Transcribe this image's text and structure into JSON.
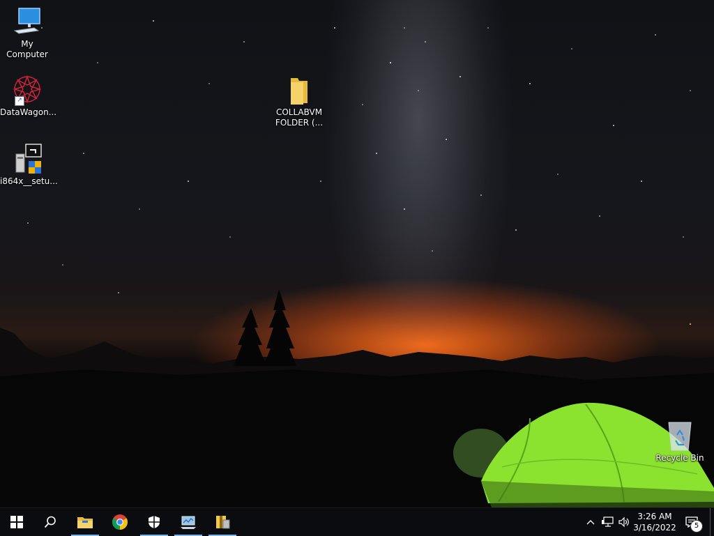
{
  "desktop": {
    "icons": [
      {
        "label": "My Computer",
        "icon": "computer-icon"
      },
      {
        "label": "DataWagon...",
        "icon": "datawagon-icon"
      },
      {
        "label": "i864x__setu...",
        "icon": "installer-icon"
      },
      {
        "label": "COLLABVM\nFOLDER (...",
        "icon": "folder-icon"
      },
      {
        "label": "Recycle Bin",
        "icon": "recycle-bin-icon"
      }
    ]
  },
  "taskbar": {
    "start": {
      "icon": "windows-start-icon"
    },
    "search": {
      "icon": "search-icon"
    },
    "pinned": [
      {
        "name": "File Explorer",
        "icon": "file-explorer-icon",
        "running": true
      },
      {
        "name": "Google Chrome",
        "icon": "chrome-icon",
        "running": false
      },
      {
        "name": "Windows Security",
        "icon": "shield-icon",
        "running": true
      },
      {
        "name": "Control Panel",
        "icon": "control-panel-icon",
        "running": true
      },
      {
        "name": "Archive Tool",
        "icon": "archive-icon",
        "running": true
      }
    ],
    "tray": {
      "chevron": "chevron-up-icon",
      "network": "network-icon",
      "volume": "volume-icon"
    },
    "clock": {
      "time": "3:26 AM",
      "date": "3/16/2022"
    },
    "notifications": {
      "icon": "action-center-icon",
      "count": "5"
    }
  },
  "colors": {
    "accent": "#76b9ed",
    "taskbar": "#0b0c0f",
    "tent": "#8be32f"
  }
}
